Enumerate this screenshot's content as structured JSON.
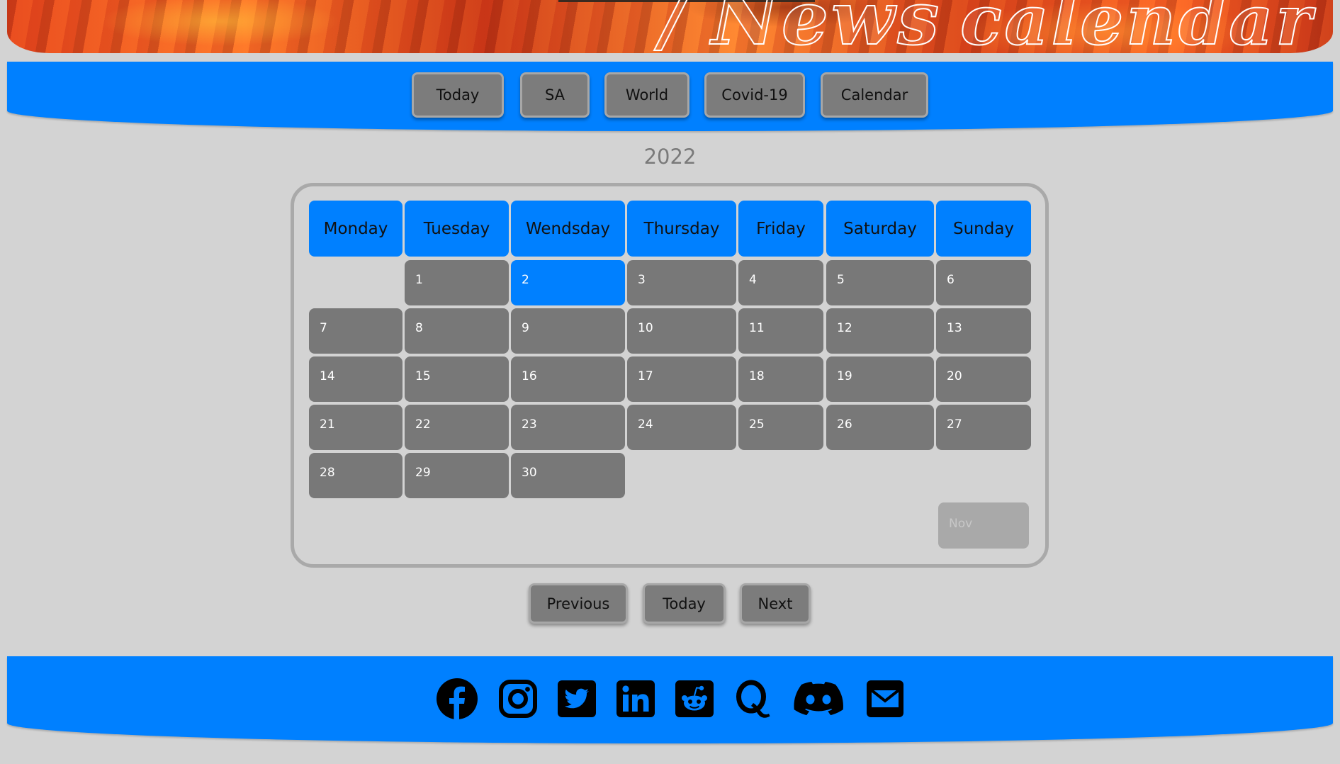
{
  "banner": {
    "title_word": "News",
    "title_script": "calendar"
  },
  "nav": [
    {
      "label": "Today"
    },
    {
      "label": "SA"
    },
    {
      "label": "World"
    },
    {
      "label": "Covid-19"
    },
    {
      "label": "Calendar"
    }
  ],
  "calendar": {
    "year": "2022",
    "weekdays": [
      "Monday",
      "Tuesday",
      "Wendsday",
      "Thursday",
      "Friday",
      "Saturday",
      "Sunday"
    ],
    "days": [
      "1",
      "2",
      "3",
      "4",
      "5",
      "6",
      "7",
      "8",
      "9",
      "10",
      "11",
      "12",
      "13",
      "14",
      "15",
      "16",
      "17",
      "18",
      "19",
      "20",
      "21",
      "22",
      "23",
      "24",
      "25",
      "26",
      "27",
      "28",
      "29",
      "30"
    ],
    "highlighted_day": "2",
    "next_month_label": "Nov"
  },
  "pager": {
    "previous": "Previous",
    "today": "Today",
    "next": "Next"
  },
  "social": [
    {
      "icon": "facebook-icon"
    },
    {
      "icon": "instagram-icon"
    },
    {
      "icon": "twitter-icon"
    },
    {
      "icon": "linkedin-icon"
    },
    {
      "icon": "reddit-icon"
    },
    {
      "icon": "quora-icon"
    },
    {
      "icon": "discord-icon"
    },
    {
      "icon": "email-icon"
    }
  ],
  "colors": {
    "accent": "#0080ff",
    "background": "#d3d3d3",
    "cell": "#787878",
    "button": "#7c7c7c"
  }
}
